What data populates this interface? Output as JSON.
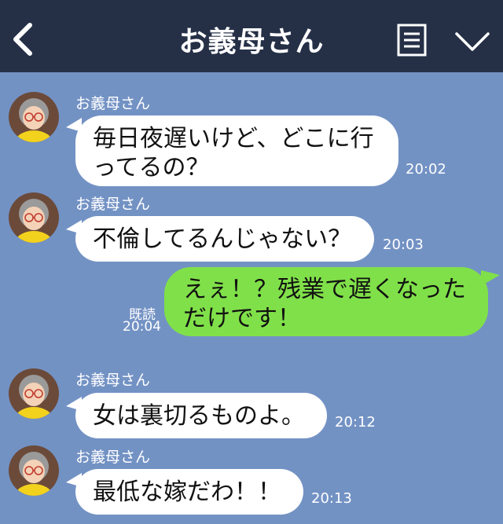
{
  "header": {
    "title": "お義母さん"
  },
  "messages": [
    {
      "sender": "お義母さん",
      "lines": [
        "毎日夜遅いけど、どこに行",
        "ってるの？"
      ],
      "time": "20:02"
    },
    {
      "sender": "お義母さん",
      "lines": [
        "不倫してるんじゃない？"
      ],
      "time": "20:03"
    },
    {
      "lines": [
        "えぇ！？残業で遅くなった",
        "だけです！"
      ],
      "read": "既読",
      "time": "20:04"
    },
    {
      "sender": "お義母さん",
      "lines": [
        "女は裏切るものよ。"
      ],
      "time": "20:12"
    },
    {
      "sender": "お義母さん",
      "lines": [
        "最低な嫁だわ！！"
      ],
      "time": "20:13"
    }
  ],
  "colors": {
    "header_bg": "#253047",
    "chat_bg": "#7392c4",
    "incoming_bubble": "#ffffff",
    "outgoing_bubble": "#80e049"
  }
}
